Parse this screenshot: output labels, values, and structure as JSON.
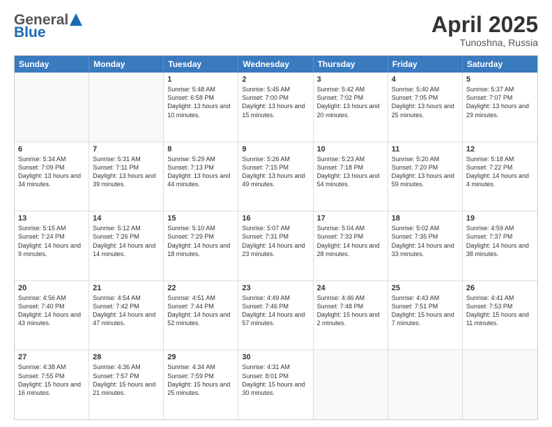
{
  "header": {
    "logo_general": "General",
    "logo_blue": "Blue",
    "month_title": "April 2025",
    "location": "Tunoshna, Russia"
  },
  "days_of_week": [
    "Sunday",
    "Monday",
    "Tuesday",
    "Wednesday",
    "Thursday",
    "Friday",
    "Saturday"
  ],
  "weeks": [
    [
      {
        "day": "",
        "sunrise": "",
        "sunset": "",
        "daylight": ""
      },
      {
        "day": "",
        "sunrise": "",
        "sunset": "",
        "daylight": ""
      },
      {
        "day": "1",
        "sunrise": "Sunrise: 5:48 AM",
        "sunset": "Sunset: 6:58 PM",
        "daylight": "Daylight: 13 hours and 10 minutes."
      },
      {
        "day": "2",
        "sunrise": "Sunrise: 5:45 AM",
        "sunset": "Sunset: 7:00 PM",
        "daylight": "Daylight: 13 hours and 15 minutes."
      },
      {
        "day": "3",
        "sunrise": "Sunrise: 5:42 AM",
        "sunset": "Sunset: 7:02 PM",
        "daylight": "Daylight: 13 hours and 20 minutes."
      },
      {
        "day": "4",
        "sunrise": "Sunrise: 5:40 AM",
        "sunset": "Sunset: 7:05 PM",
        "daylight": "Daylight: 13 hours and 25 minutes."
      },
      {
        "day": "5",
        "sunrise": "Sunrise: 5:37 AM",
        "sunset": "Sunset: 7:07 PM",
        "daylight": "Daylight: 13 hours and 29 minutes."
      }
    ],
    [
      {
        "day": "6",
        "sunrise": "Sunrise: 5:34 AM",
        "sunset": "Sunset: 7:09 PM",
        "daylight": "Daylight: 13 hours and 34 minutes."
      },
      {
        "day": "7",
        "sunrise": "Sunrise: 5:31 AM",
        "sunset": "Sunset: 7:11 PM",
        "daylight": "Daylight: 13 hours and 39 minutes."
      },
      {
        "day": "8",
        "sunrise": "Sunrise: 5:29 AM",
        "sunset": "Sunset: 7:13 PM",
        "daylight": "Daylight: 13 hours and 44 minutes."
      },
      {
        "day": "9",
        "sunrise": "Sunrise: 5:26 AM",
        "sunset": "Sunset: 7:15 PM",
        "daylight": "Daylight: 13 hours and 49 minutes."
      },
      {
        "day": "10",
        "sunrise": "Sunrise: 5:23 AM",
        "sunset": "Sunset: 7:18 PM",
        "daylight": "Daylight: 13 hours and 54 minutes."
      },
      {
        "day": "11",
        "sunrise": "Sunrise: 5:20 AM",
        "sunset": "Sunset: 7:20 PM",
        "daylight": "Daylight: 13 hours and 59 minutes."
      },
      {
        "day": "12",
        "sunrise": "Sunrise: 5:18 AM",
        "sunset": "Sunset: 7:22 PM",
        "daylight": "Daylight: 14 hours and 4 minutes."
      }
    ],
    [
      {
        "day": "13",
        "sunrise": "Sunrise: 5:15 AM",
        "sunset": "Sunset: 7:24 PM",
        "daylight": "Daylight: 14 hours and 9 minutes."
      },
      {
        "day": "14",
        "sunrise": "Sunrise: 5:12 AM",
        "sunset": "Sunset: 7:26 PM",
        "daylight": "Daylight: 14 hours and 14 minutes."
      },
      {
        "day": "15",
        "sunrise": "Sunrise: 5:10 AM",
        "sunset": "Sunset: 7:29 PM",
        "daylight": "Daylight: 14 hours and 18 minutes."
      },
      {
        "day": "16",
        "sunrise": "Sunrise: 5:07 AM",
        "sunset": "Sunset: 7:31 PM",
        "daylight": "Daylight: 14 hours and 23 minutes."
      },
      {
        "day": "17",
        "sunrise": "Sunrise: 5:04 AM",
        "sunset": "Sunset: 7:33 PM",
        "daylight": "Daylight: 14 hours and 28 minutes."
      },
      {
        "day": "18",
        "sunrise": "Sunrise: 5:02 AM",
        "sunset": "Sunset: 7:35 PM",
        "daylight": "Daylight: 14 hours and 33 minutes."
      },
      {
        "day": "19",
        "sunrise": "Sunrise: 4:59 AM",
        "sunset": "Sunset: 7:37 PM",
        "daylight": "Daylight: 14 hours and 38 minutes."
      }
    ],
    [
      {
        "day": "20",
        "sunrise": "Sunrise: 4:56 AM",
        "sunset": "Sunset: 7:40 PM",
        "daylight": "Daylight: 14 hours and 43 minutes."
      },
      {
        "day": "21",
        "sunrise": "Sunrise: 4:54 AM",
        "sunset": "Sunset: 7:42 PM",
        "daylight": "Daylight: 14 hours and 47 minutes."
      },
      {
        "day": "22",
        "sunrise": "Sunrise: 4:51 AM",
        "sunset": "Sunset: 7:44 PM",
        "daylight": "Daylight: 14 hours and 52 minutes."
      },
      {
        "day": "23",
        "sunrise": "Sunrise: 4:49 AM",
        "sunset": "Sunset: 7:46 PM",
        "daylight": "Daylight: 14 hours and 57 minutes."
      },
      {
        "day": "24",
        "sunrise": "Sunrise: 4:46 AM",
        "sunset": "Sunset: 7:48 PM",
        "daylight": "Daylight: 15 hours and 2 minutes."
      },
      {
        "day": "25",
        "sunrise": "Sunrise: 4:43 AM",
        "sunset": "Sunset: 7:51 PM",
        "daylight": "Daylight: 15 hours and 7 minutes."
      },
      {
        "day": "26",
        "sunrise": "Sunrise: 4:41 AM",
        "sunset": "Sunset: 7:53 PM",
        "daylight": "Daylight: 15 hours and 11 minutes."
      }
    ],
    [
      {
        "day": "27",
        "sunrise": "Sunrise: 4:38 AM",
        "sunset": "Sunset: 7:55 PM",
        "daylight": "Daylight: 15 hours and 16 minutes."
      },
      {
        "day": "28",
        "sunrise": "Sunrise: 4:36 AM",
        "sunset": "Sunset: 7:57 PM",
        "daylight": "Daylight: 15 hours and 21 minutes."
      },
      {
        "day": "29",
        "sunrise": "Sunrise: 4:34 AM",
        "sunset": "Sunset: 7:59 PM",
        "daylight": "Daylight: 15 hours and 25 minutes."
      },
      {
        "day": "30",
        "sunrise": "Sunrise: 4:31 AM",
        "sunset": "Sunset: 8:01 PM",
        "daylight": "Daylight: 15 hours and 30 minutes."
      },
      {
        "day": "",
        "sunrise": "",
        "sunset": "",
        "daylight": ""
      },
      {
        "day": "",
        "sunrise": "",
        "sunset": "",
        "daylight": ""
      },
      {
        "day": "",
        "sunrise": "",
        "sunset": "",
        "daylight": ""
      }
    ]
  ]
}
